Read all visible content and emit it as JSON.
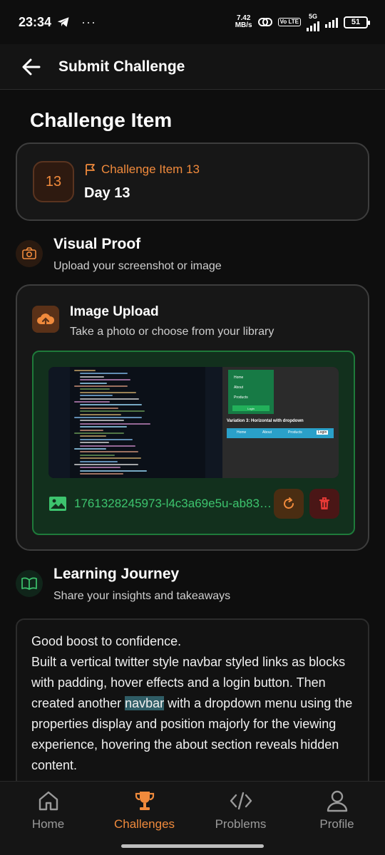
{
  "status_bar": {
    "time": "23:34",
    "more": "···",
    "net_speed_value": "7.42",
    "net_speed_unit": "MB/s",
    "volte": "Vo LTE",
    "network": "5G",
    "battery": "51"
  },
  "app_bar": {
    "title": "Submit Challenge"
  },
  "page": {
    "heading": "Challenge Item"
  },
  "challenge_item": {
    "number": "13",
    "tag": "Challenge Item 13",
    "day": "Day 13"
  },
  "visual_proof": {
    "title": "Visual Proof",
    "subtitle": "Upload your screenshot or image"
  },
  "image_upload": {
    "title": "Image Upload",
    "subtitle": "Take a photo or choose from your library",
    "file_name": "1761328245973-l4c3a69e5u-ab83…",
    "preview": {
      "nav_items": [
        "Home",
        "About",
        "Products"
      ],
      "login_label": "Login",
      "variation_label": "Variation 3: Horizontal with dropdown",
      "horizontal_items": [
        "Home",
        "About",
        "Products"
      ],
      "horizontal_login": "Login"
    }
  },
  "learning_journey": {
    "title": "Learning Journey",
    "subtitle": "Share your insights and takeaways",
    "text_before": "Good boost to confidence.\nBuilt a vertical twitter style navbar styled links as blocks with padding, hover effects and a login button. Then created another ",
    "text_highlight": "navbar",
    "text_after": " with a dropdown menu using the properties display and position majorly for the viewing experience, hovering the about section reveals hidden content."
  },
  "bottom_nav": {
    "items": [
      {
        "label": "Home",
        "icon": "home-icon",
        "active": false
      },
      {
        "label": "Challenges",
        "icon": "trophy-icon",
        "active": true
      },
      {
        "label": "Problems",
        "icon": "code-icon",
        "active": false
      },
      {
        "label": "Profile",
        "icon": "person-icon",
        "active": false
      }
    ]
  },
  "colors": {
    "accent": "#f08a3c",
    "success": "#3dc46e",
    "danger": "#e53935",
    "background": "#0e0e0e"
  }
}
